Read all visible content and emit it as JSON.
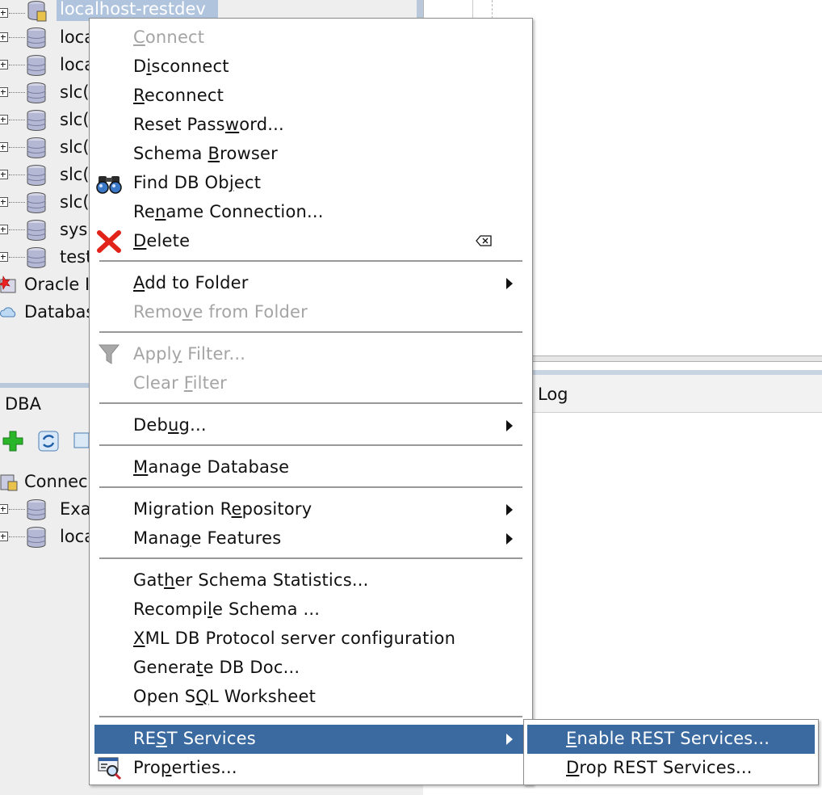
{
  "navigator": {
    "top_selected_label": "localhost-restdev",
    "connections": [
      {
        "label": "loca"
      },
      {
        "label": "loca"
      },
      {
        "label": "slc("
      },
      {
        "label": "slc("
      },
      {
        "label": "slc("
      },
      {
        "label": "slc("
      },
      {
        "label": "slc("
      },
      {
        "label": "sys"
      },
      {
        "label": "test"
      }
    ],
    "folder_items": [
      {
        "label": "Oracle I"
      },
      {
        "label": "Databas"
      }
    ]
  },
  "dba": {
    "title": "DBA",
    "root_label": "Connec",
    "items": [
      {
        "label": "Exa"
      },
      {
        "label": "loca"
      }
    ]
  },
  "log_panel": {
    "title": "Log"
  },
  "context_menu": {
    "items": {
      "connect": {
        "pre": "",
        "u": "C",
        "post": "onnect"
      },
      "disconnect": {
        "pre": "D",
        "u": "i",
        "post": "sconnect"
      },
      "reconnect": {
        "pre": "",
        "u": "R",
        "post": "econnect"
      },
      "reset_password": {
        "pre": "Reset Pass",
        "u": "w",
        "post": "ord..."
      },
      "schema_browser": {
        "pre": "Schema ",
        "u": "B",
        "post": "rowser"
      },
      "find_db_object": {
        "pre": "Find DB Ob",
        "u": "j",
        "post": "ect"
      },
      "rename_connection": {
        "pre": "Re",
        "u": "n",
        "post": "ame Connection..."
      },
      "delete": {
        "pre": "",
        "u": "D",
        "post": "elete"
      },
      "add_to_folder": {
        "pre": "",
        "u": "A",
        "post": "dd to Folder"
      },
      "remove_from_folder": {
        "pre": "Remo",
        "u": "v",
        "post": "e from Folder"
      },
      "apply_filter": {
        "pre": "Appl",
        "u": "y",
        "post": " Filter..."
      },
      "clear_filter": {
        "pre": "Clear ",
        "u": "F",
        "post": "ilter"
      },
      "debug": {
        "pre": "Deb",
        "u": "u",
        "post": "g..."
      },
      "manage_database": {
        "pre": "",
        "u": "M",
        "post": "anage Database"
      },
      "migration_repository": {
        "pre": "Migration R",
        "u": "e",
        "post": "pository"
      },
      "manage_features": {
        "pre": "Mana",
        "u": "g",
        "post": "e Features"
      },
      "gather_schema_statistics": {
        "pre": "Gat",
        "u": "h",
        "post": "er Schema Statistics..."
      },
      "recompile_schema": {
        "pre": "Recompi",
        "u": "l",
        "post": "e Schema ..."
      },
      "xml_db_protocol": {
        "pre": "",
        "u": "X",
        "post": "ML DB Protocol server configuration"
      },
      "generate_db_doc": {
        "pre": "Genera",
        "u": "t",
        "post": "e DB Doc..."
      },
      "open_sql_worksheet": {
        "pre": "Open S",
        "u": "Q",
        "post": "L Worksheet"
      },
      "rest_services": {
        "pre": "RE",
        "u": "S",
        "post": "T Services"
      },
      "properties": {
        "pre": "Pro",
        "u": "p",
        "post": "erties..."
      }
    }
  },
  "submenu": {
    "enable_rest": {
      "pre": "",
      "u": "E",
      "post": "nable REST Services..."
    },
    "drop_rest": {
      "pre": "",
      "u": "D",
      "post": "rop REST Services..."
    }
  },
  "colors": {
    "highlight": "#3b6aa0",
    "disabled_text": "#a4a4a4",
    "selection": "#b0c4de"
  }
}
